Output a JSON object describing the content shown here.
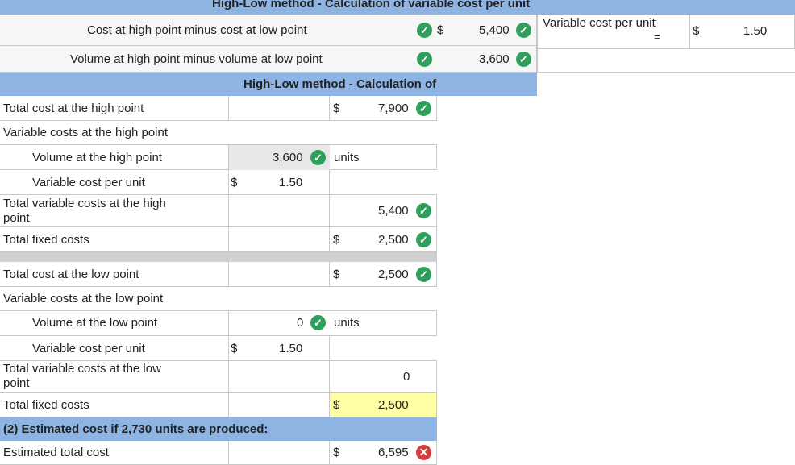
{
  "top_header": "High-Low method - Calculation of variable cost per unit",
  "variable_section": {
    "row1_label": "Cost at high point minus cost at low point",
    "row1_dollar": "$",
    "row1_value": "5,400",
    "row2_label": "Volume at high point minus volume at low point",
    "row2_value": "3,600",
    "result_label": "Variable cost per unit",
    "result_equals": "=",
    "result_dollar": "$",
    "result_value": "1.50"
  },
  "fixed_header": "High-Low method - Calculation of fixed costs",
  "high": {
    "total_cost_label": "Total cost at the high point",
    "total_cost_dollar": "$",
    "total_cost_value": "7,900",
    "var_costs_label": "Variable costs at the high point",
    "volume_label": "Volume at the high point",
    "volume_value": "3,600",
    "volume_unit": "units",
    "vcpu_label": "Variable cost per unit",
    "vcpu_dollar": "$",
    "vcpu_value": "1.50",
    "total_var_label_1": "Total variable costs at the high",
    "total_var_label_2": "point",
    "total_var_value": "5,400",
    "fixed_label": "Total fixed costs",
    "fixed_dollar": "$",
    "fixed_value": "2,500"
  },
  "low": {
    "total_cost_label": "Total cost at the low point",
    "total_cost_dollar": "$",
    "total_cost_value": "2,500",
    "var_costs_label": "Variable costs at the low point",
    "volume_label": "Volume at the low point",
    "volume_value": "0",
    "volume_unit": "units",
    "vcpu_label": "Variable cost per unit",
    "vcpu_dollar": "$",
    "vcpu_value": "1.50",
    "total_var_label_1": "Total variable costs at the low",
    "total_var_label_2": "point",
    "total_var_value": "0",
    "fixed_label": "Total fixed costs",
    "fixed_dollar": "$",
    "fixed_value": "2,500"
  },
  "estimate": {
    "header": "(2) Estimated cost if 2,730 units are produced:",
    "label": "Estimated total cost",
    "dollar": "$",
    "value": "6,595"
  },
  "icons": {
    "correct": "check-circle-icon",
    "incorrect": "x-circle-icon"
  },
  "colors": {
    "header_blue": "#8eb4e3",
    "input_yellow": "#ffffa6",
    "check_green": "#2fa05b",
    "error_red": "#d93a3a"
  }
}
